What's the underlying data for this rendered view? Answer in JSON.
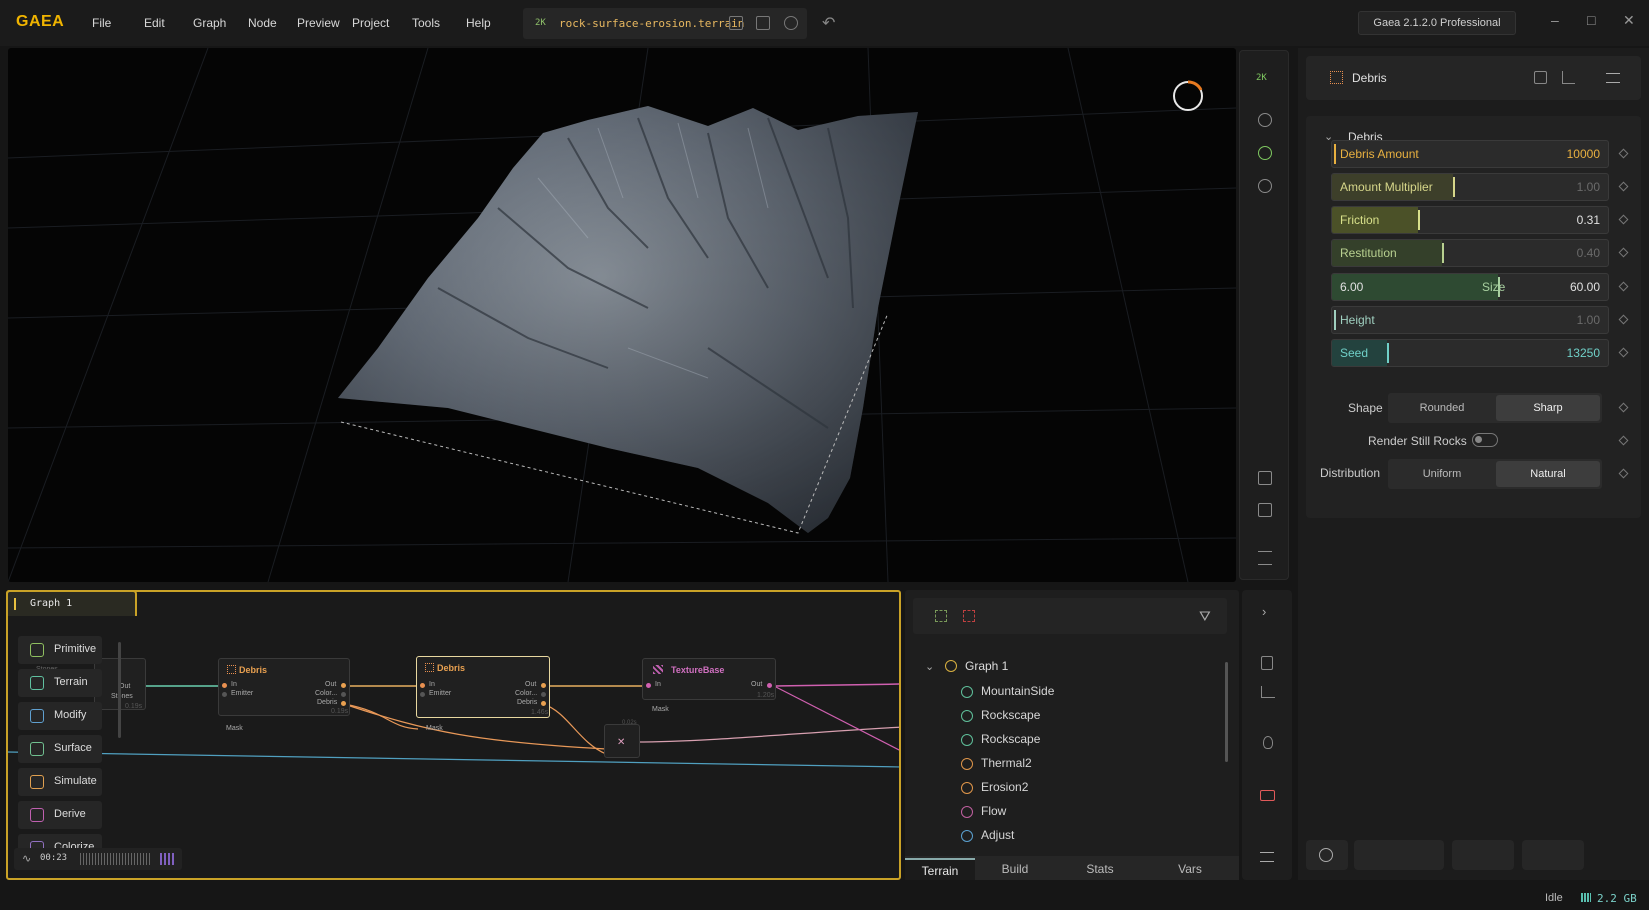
{
  "app": {
    "logo": "GAEA",
    "menu": [
      "File",
      "Edit",
      "Graph",
      "Node",
      "Preview",
      "Project",
      "Tools",
      "Help"
    ],
    "resolution_badge": "2K",
    "filename": "rock-surface-erosion.terrain",
    "version": "Gaea 2.1.2.0 Professional",
    "window_controls": [
      "–",
      "□",
      "✕"
    ]
  },
  "viewport": {
    "toolbar_badge": "2K"
  },
  "properties": {
    "node_name": "Debris",
    "section_title": "Debris",
    "sliders": [
      {
        "label": "Debris Amount",
        "value": "10000",
        "fill": 0.0,
        "label_color": "#e8b040",
        "value_color": "#e8b040",
        "fill_color": "#2b2b2b"
      },
      {
        "label": "Amount Multiplier",
        "value": "1.00",
        "fill": 0.44,
        "label_color": "#d6d68a",
        "value_color": "#6a6a6a",
        "fill_color": "#3d3f2a"
      },
      {
        "label": "Friction",
        "value": "0.31",
        "fill": 0.31,
        "label_color": "#d8e08a",
        "value_color": "#e0e0e0",
        "fill_color": "#4b5128"
      },
      {
        "label": "Restitution",
        "value": "0.40",
        "fill": 0.4,
        "label_color": "#b8d090",
        "value_color": "#6a6a6a",
        "fill_color": "#34402a"
      },
      {
        "label": "Size",
        "value": "60.00",
        "range_low": "6.00",
        "fill": 0.6,
        "label_color": "#a8d0a0",
        "value_color": "#e0e0e0",
        "fill_color": "#2e4a32"
      },
      {
        "label": "Height",
        "value": "1.00",
        "fill": 0.0,
        "label_color": "#a0d0c0",
        "value_color": "#6a6a6a",
        "fill_color": "#2b2b2b"
      },
      {
        "label": "Seed",
        "value": "13250",
        "fill": 0.2,
        "label_color": "#70d0c8",
        "value_color": "#70d0c8",
        "fill_color": "#23423e"
      }
    ],
    "shape": {
      "label": "Shape",
      "options": [
        "Rounded",
        "Sharp"
      ],
      "selected": "Sharp"
    },
    "render_still_rocks": {
      "label": "Render Still Rocks",
      "on": false
    },
    "distribution": {
      "label": "Distribution",
      "options": [
        "Uniform",
        "Natural"
      ],
      "selected": "Natural"
    }
  },
  "graph": {
    "tab": "Graph 1",
    "palette": [
      "Primitive",
      "Terrain",
      "Modify",
      "Surface",
      "Simulate",
      "Derive",
      "Colorize"
    ],
    "timer": "00:23",
    "nodes": [
      {
        "title": "Debris",
        "inputs": [
          "In",
          "Emitter"
        ],
        "outputs": [
          "Out",
          "Color...",
          "Debris"
        ],
        "footer": "Mask",
        "time": "0.19s"
      },
      {
        "title": "Debris",
        "inputs": [
          "In",
          "Emitter"
        ],
        "outputs": [
          "Out",
          "Color...",
          "Debris"
        ],
        "footer": "Mask",
        "time": "1.46s"
      },
      {
        "title": "TextureBase",
        "inputs": [
          "In"
        ],
        "outputs": [
          "Out"
        ],
        "footer": "Mask",
        "time": "1.20s"
      }
    ],
    "partial_node": {
      "outputs": [
        "Out",
        "Stones"
      ],
      "time": "0.19s",
      "ghost_label": "Stones"
    },
    "combine_time": "0.02s"
  },
  "tree": {
    "root": "Graph 1",
    "items": [
      {
        "label": "MountainSide",
        "color": "#5fbf9a"
      },
      {
        "label": "Rockscape",
        "color": "#5fbf9a"
      },
      {
        "label": "Rockscape",
        "color": "#5fbf9a"
      },
      {
        "label": "Thermal2",
        "color": "#e0964a"
      },
      {
        "label": "Erosion2",
        "color": "#e0964a"
      },
      {
        "label": "Flow",
        "color": "#c060a0"
      },
      {
        "label": "Adjust",
        "color": "#5aa0d0"
      }
    ],
    "tabs": [
      "Terrain",
      "Build",
      "Stats",
      "Vars"
    ],
    "active_tab": "Terrain"
  },
  "status": {
    "state": "Idle",
    "memory": "2.2 GB"
  }
}
